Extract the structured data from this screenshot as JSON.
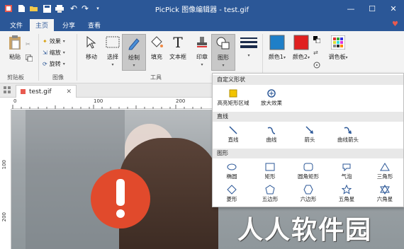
{
  "window": {
    "title": "PicPick 图像编辑器 - test.gif",
    "bg_color": "#2b5797"
  },
  "menu_tabs": [
    "文件",
    "主页",
    "分享",
    "查看"
  ],
  "ribbon": {
    "clipboard": {
      "paste": "粘贴",
      "group": "剪贴板"
    },
    "image": {
      "effects": "效果",
      "resize": "缩放",
      "rotate": "旋转",
      "group": "图像"
    },
    "tools": {
      "move": "移动",
      "select": "选择",
      "draw": "绘制",
      "fill": "填充",
      "text": "文本框",
      "stamp": "印章",
      "shape": "图形",
      "group": "工具"
    },
    "colors": {
      "color1": "颜色1",
      "color2": "颜色2",
      "palette": "调色板",
      "color1_value": "#1f7fc8",
      "color2_value": "#e02020"
    }
  },
  "document": {
    "tab_name": "test.gif"
  },
  "ruler": {
    "h": [
      "0",
      "100",
      "200"
    ],
    "v": [
      "100",
      "200"
    ]
  },
  "shape_panel": {
    "custom_header": "自定义形状",
    "custom": [
      "高亮矩形区域",
      "放大效果"
    ],
    "lines_header": "直线",
    "lines": [
      "直线",
      "曲线",
      "箭头",
      "曲线箭头"
    ],
    "shapes_header": "图形",
    "shapes_row1": [
      "椭圆",
      "矩形",
      "圆角矩形",
      "气泡",
      "三角形"
    ],
    "shapes_row2": [
      "菱形",
      "五边形",
      "六边形",
      "五角星",
      "六角星"
    ]
  },
  "watermark": "人人软件园"
}
